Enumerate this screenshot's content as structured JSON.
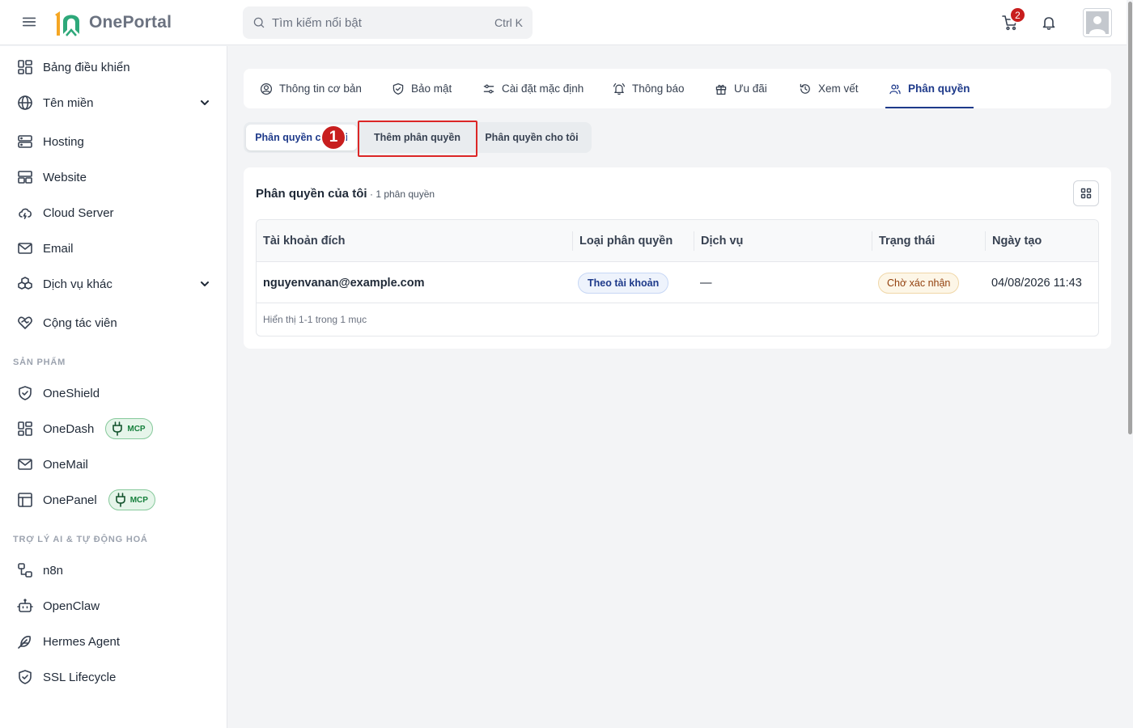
{
  "app": {
    "brand": "OnePortal",
    "logo_mark": "1Ω"
  },
  "header": {
    "search_placeholder": "Tìm kiếm nổi bật",
    "search_shortcut": "Ctrl K",
    "cart_count": "2"
  },
  "sidebar": {
    "items": [
      {
        "label": "Bảng điều khiển",
        "icon": "dashboard-icon"
      },
      {
        "label": "Tên miền",
        "icon": "globe-icon",
        "expandable": true
      },
      {
        "label": "Hosting",
        "icon": "server-icon"
      },
      {
        "label": "Website",
        "icon": "website-icon"
      },
      {
        "label": "Cloud Server",
        "icon": "cloud-icon"
      },
      {
        "label": "Email",
        "icon": "mail-icon"
      },
      {
        "label": "Dịch vụ khác",
        "icon": "boxes-icon",
        "expandable": true
      },
      {
        "label": "Cộng tác viên",
        "icon": "handshake-heart-icon"
      }
    ],
    "section_products": "SẢN PHẨM",
    "products": [
      {
        "label": "OneShield",
        "icon": "shield-icon"
      },
      {
        "label": "OneDash",
        "icon": "dashboard-icon",
        "badge": "MCP"
      },
      {
        "label": "OneMail",
        "icon": "mail-icon"
      },
      {
        "label": "OnePanel",
        "icon": "panel-icon",
        "badge": "MCP"
      }
    ],
    "section_ai": "TRỢ LÝ AI & TỰ ĐỘNG HOÁ",
    "ai": [
      {
        "label": "n8n",
        "icon": "workflow-icon"
      },
      {
        "label": "OpenClaw",
        "icon": "bot-icon"
      },
      {
        "label": "Hermes Agent",
        "icon": "feather-icon"
      },
      {
        "label": "SSL Lifecycle",
        "icon": "shield-check-icon"
      }
    ]
  },
  "tabs": [
    {
      "label": "Thông tin cơ bản",
      "icon": "user-circle-icon"
    },
    {
      "label": "Bảo mật",
      "icon": "shield-check-icon"
    },
    {
      "label": "Cài đặt mặc định",
      "icon": "sliders-icon"
    },
    {
      "label": "Thông báo",
      "icon": "bell-ring-icon"
    },
    {
      "label": "Ưu đãi",
      "icon": "gift-icon"
    },
    {
      "label": "Xem vết",
      "icon": "history-icon"
    },
    {
      "label": "Phân quyền",
      "icon": "users-icon",
      "active": true
    }
  ],
  "subtabs": {
    "items": [
      "Phân quyền của tôi",
      "Thêm phân quyền",
      "Phân quyền cho tôi"
    ],
    "active_index": 0,
    "highlighted_index": 1,
    "step_marker": "1"
  },
  "card": {
    "title": "Phân quyền của tôi",
    "count": "· 1 phân quyền"
  },
  "table": {
    "columns": [
      "Tài khoản đích",
      "Loại phân quyền",
      "Dịch vụ",
      "Trạng thái",
      "Ngày tạo"
    ],
    "rows": [
      {
        "account": "nguyenvanan@example.com",
        "type": "Theo tài khoản",
        "service": "—",
        "status": "Chờ xác nhận",
        "created": "04/08/2026 11:43"
      }
    ],
    "footer": "Hiển thị 1-1 trong 1 mục"
  },
  "colors": {
    "accent": "#1e3a8a",
    "danger": "#dc2626",
    "mcp_green": "#16803c",
    "logo_orange": "#f5a623",
    "logo_green": "#2ea87a"
  }
}
